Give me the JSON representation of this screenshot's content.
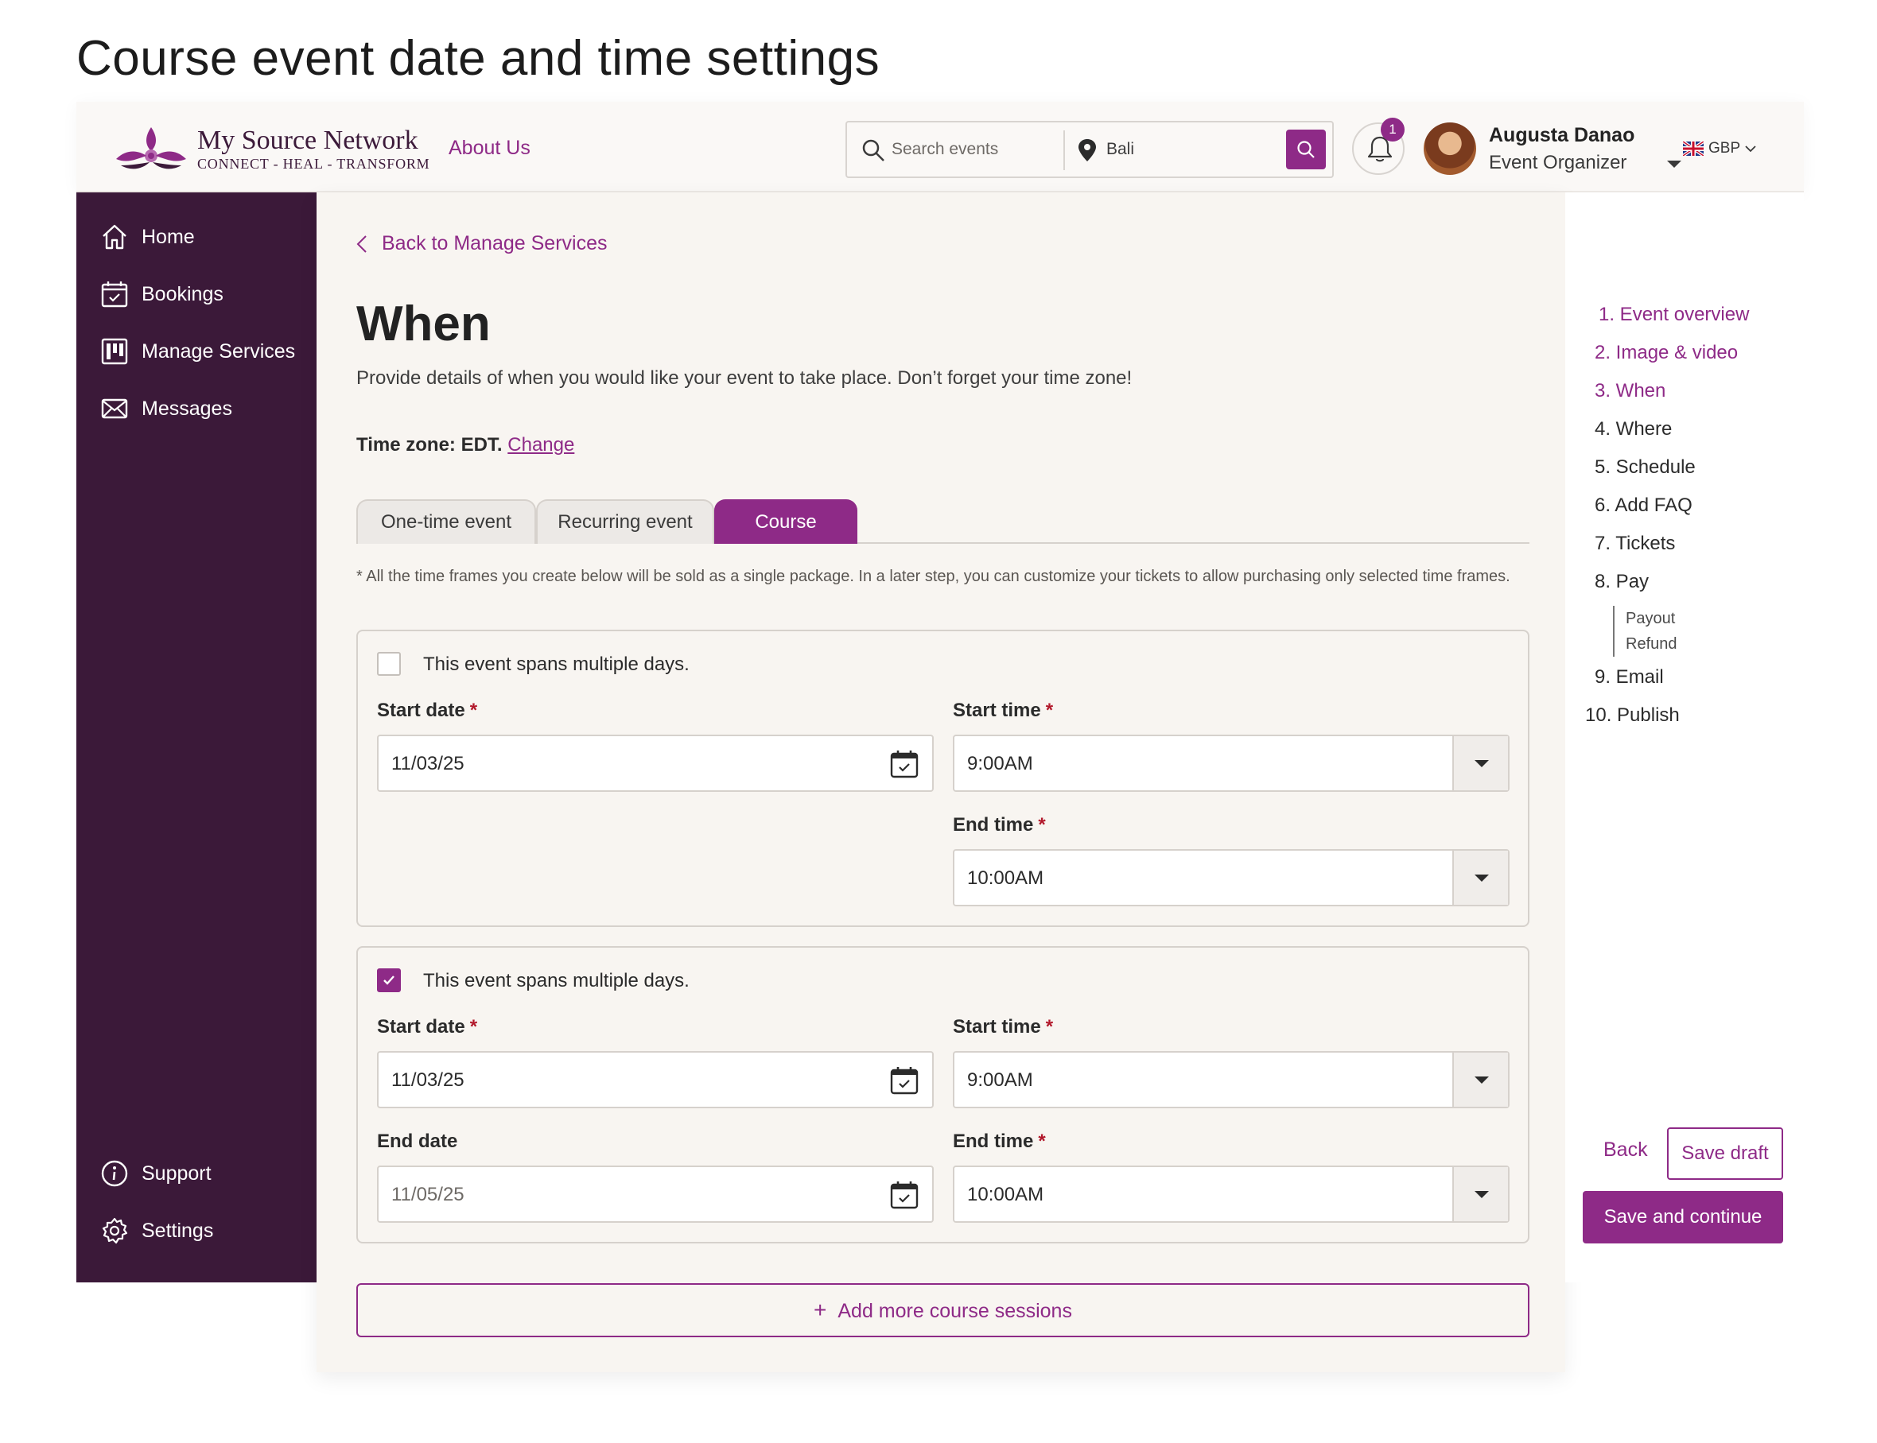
{
  "page_heading": "Course event date and time settings",
  "header": {
    "logo_name": "My Source Network",
    "logo_tagline": "CONNECT - HEAL - TRANSFORM",
    "about_link": "About Us",
    "search_placeholder": "Search events",
    "location_value": "Bali",
    "notification_count": "1",
    "user_name": "Augusta Danao",
    "user_role": "Event Organizer",
    "currency": "GBP"
  },
  "sidebar": {
    "items": [
      {
        "label": "Home",
        "icon": "home-icon"
      },
      {
        "label": "Bookings",
        "icon": "calendar-icon"
      },
      {
        "label": "Manage Services",
        "icon": "board-icon"
      },
      {
        "label": "Messages",
        "icon": "mail-icon"
      }
    ],
    "bottom_items": [
      {
        "label": "Support",
        "icon": "info-icon"
      },
      {
        "label": "Settings",
        "icon": "gear-icon"
      }
    ]
  },
  "main": {
    "back_link": "Back to Manage Services",
    "title": "When",
    "subtitle": "Provide details of when you would like your event to take place. Don’t forget your time zone!",
    "timezone_label": "Time zone: EDT.",
    "timezone_change": "Change",
    "tabs": [
      {
        "label": "One-time event",
        "active": false
      },
      {
        "label": "Recurring event",
        "active": false
      },
      {
        "label": "Course",
        "active": true
      }
    ],
    "note": "* All the time frames you create below will be sold as a single package. In a later step, you can customize your tickets to allow purchasing only selected time frames.",
    "sessions": [
      {
        "multi_day_label": "This event spans multiple days.",
        "multi_day_checked": false,
        "start_date_label": "Start date",
        "start_date": "11/03/25",
        "start_time_label": "Start time",
        "start_time": "9:00AM",
        "end_time_label": "End time",
        "end_time": "10:00AM"
      },
      {
        "multi_day_label": "This event spans multiple days.",
        "multi_day_checked": true,
        "start_date_label": "Start date",
        "start_date": "11/03/25",
        "start_time_label": "Start time",
        "start_time": "9:00AM",
        "end_date_label": "End date",
        "end_date": "11/05/25",
        "end_time_label": "End time",
        "end_time": "10:00AM"
      }
    ],
    "required_mark": "*",
    "add_sessions": "Add more course sessions"
  },
  "steps": {
    "items": [
      {
        "label": "1. Event overview",
        "done": true
      },
      {
        "label": "2. Image & video",
        "done": true
      },
      {
        "label": "3. When",
        "done": true
      },
      {
        "label": "4. Where",
        "done": false
      },
      {
        "label": "5. Schedule",
        "done": false
      },
      {
        "label": "6. Add FAQ",
        "done": false
      },
      {
        "label": "7. Tickets",
        "done": false
      },
      {
        "label": "8. Pay",
        "done": false
      },
      {
        "label": "9. Email",
        "done": false
      },
      {
        "label": "10. Publish",
        "done": false
      }
    ],
    "pay_substeps": [
      "Payout",
      "Refund"
    ],
    "back_button": "Back",
    "save_draft_button": "Save draft",
    "save_continue_button": "Save and continue"
  },
  "colors": {
    "accent": "#8e2a87",
    "sidebar_bg": "#3b1939",
    "content_bg": "#f8f5f1",
    "required": "#b2182b"
  }
}
